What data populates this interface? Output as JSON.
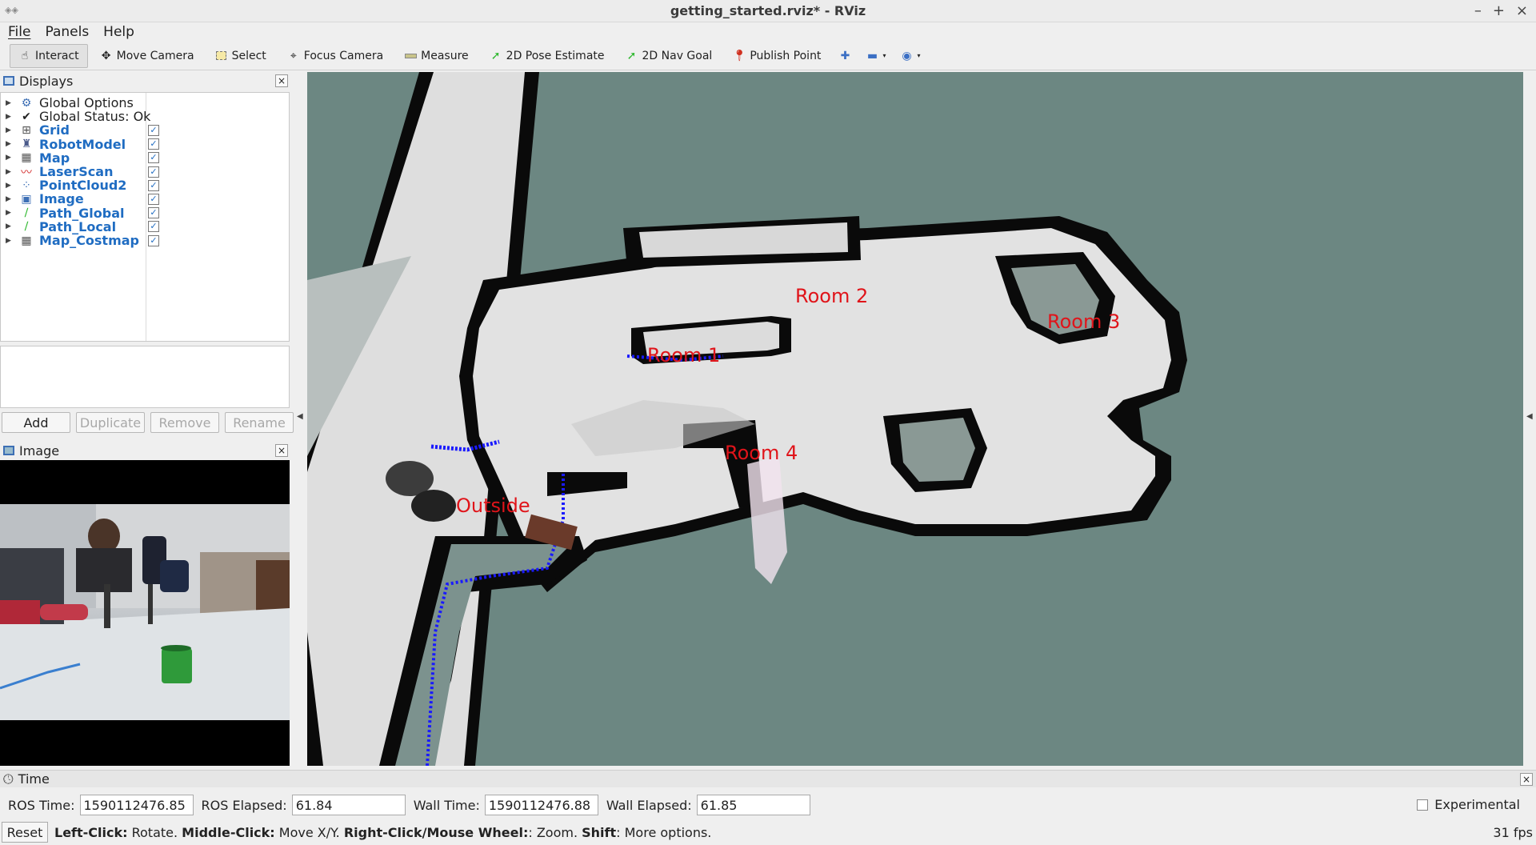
{
  "window": {
    "title": "getting_started.rviz* - RViz"
  },
  "menu": {
    "file": "File",
    "panels": "Panels",
    "help": "Help"
  },
  "toolbar": {
    "interact": "Interact",
    "move_camera": "Move Camera",
    "select": "Select",
    "focus_camera": "Focus Camera",
    "measure": "Measure",
    "pose_estimate": "2D Pose Estimate",
    "nav_goal": "2D Nav Goal",
    "publish_point": "Publish Point"
  },
  "displays": {
    "title": "Displays",
    "items": [
      {
        "label": "Global Options",
        "icon": "gear-icon",
        "checkable": false
      },
      {
        "label": "Global Status: Ok",
        "icon": "checkmark-icon",
        "checkable": false
      },
      {
        "label": "Grid",
        "icon": "grid-icon",
        "checkable": true,
        "checked": true
      },
      {
        "label": "RobotModel",
        "icon": "robot-icon",
        "checkable": true,
        "checked": true
      },
      {
        "label": "Map",
        "icon": "map-icon",
        "checkable": true,
        "checked": true
      },
      {
        "label": "LaserScan",
        "icon": "laser-icon",
        "checkable": true,
        "checked": true
      },
      {
        "label": "PointCloud2",
        "icon": "pointcloud-icon",
        "checkable": true,
        "checked": true
      },
      {
        "label": "Image",
        "icon": "image-icon",
        "checkable": true,
        "checked": true
      },
      {
        "label": "Path_Global",
        "icon": "path-icon",
        "checkable": true,
        "checked": true
      },
      {
        "label": "Path_Local",
        "icon": "path-icon",
        "checkable": true,
        "checked": true
      },
      {
        "label": "Map_Costmap",
        "icon": "map-icon",
        "checkable": true,
        "checked": true
      }
    ],
    "buttons": {
      "add": "Add",
      "duplicate": "Duplicate",
      "remove": "Remove",
      "rename": "Rename"
    }
  },
  "image_panel": {
    "title": "Image"
  },
  "view": {
    "rooms": {
      "room1": "Room 1",
      "room2": "Room 2",
      "room3": "Room 3",
      "room4": "Room 4",
      "outside": "Outside"
    }
  },
  "time": {
    "title": "Time",
    "ros_time_label": "ROS Time:",
    "ros_time": "1590112476.85",
    "ros_elapsed_label": "ROS Elapsed:",
    "ros_elapsed": "61.84",
    "wall_time_label": "Wall Time:",
    "wall_time": "1590112476.88",
    "wall_elapsed_label": "Wall Elapsed:",
    "wall_elapsed": "61.85",
    "experimental": "Experimental"
  },
  "status": {
    "reset": "Reset",
    "hint_left_key": "Left-Click:",
    "hint_left": " Rotate. ",
    "hint_middle_key": "Middle-Click:",
    "hint_middle": " Move X/Y. ",
    "hint_right_key": "Right-Click/Mouse Wheel:",
    "hint_right": ": Zoom. ",
    "hint_shift_key": "Shift",
    "hint_shift": ": More options.",
    "fps": "31 fps"
  },
  "colors": {
    "map_bg": "#6c8782",
    "free_space": "#e2e2e2",
    "wall": "#0a0a0a",
    "room_label": "#e0141a",
    "link": "#1f6cc2",
    "path": "#1a1aff"
  }
}
